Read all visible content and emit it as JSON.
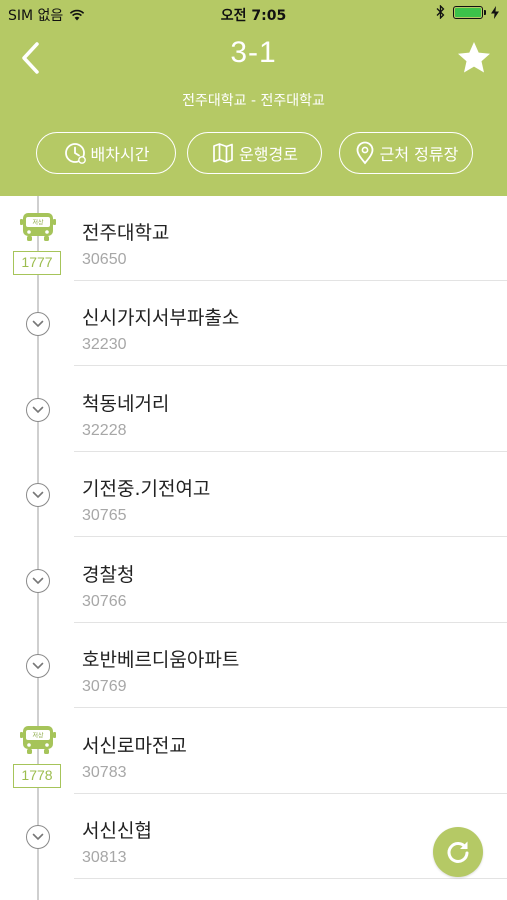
{
  "status_bar": {
    "carrier": "SIM 없음",
    "time": "오전 7:05",
    "battery_level": 1.0
  },
  "header": {
    "route_number": "3-1",
    "route_endpoints": "전주대학교 - 전주대학교",
    "buttons": {
      "schedule": "배차시간",
      "route_map": "운행경로",
      "nearby": "근처 정류장"
    }
  },
  "colors": {
    "primary": "#b5c965",
    "bus_badge": "#9cbd4f",
    "stop_code": "#a7a7a7"
  },
  "stops": [
    {
      "name": "전주대학교",
      "code": "30650",
      "bus": {
        "label": "저상",
        "number": "1777"
      }
    },
    {
      "name": "신시가지서부파출소",
      "code": "32230"
    },
    {
      "name": "척동네거리",
      "code": "32228"
    },
    {
      "name": "기전중.기전여고",
      "code": "30765"
    },
    {
      "name": "경찰청",
      "code": "30766"
    },
    {
      "name": "호반베르디움아파트",
      "code": "30769"
    },
    {
      "name": "서신로마전교",
      "code": "30783",
      "bus": {
        "label": "저상",
        "number": "1778"
      }
    },
    {
      "name": "서신신협",
      "code": "30813"
    }
  ]
}
